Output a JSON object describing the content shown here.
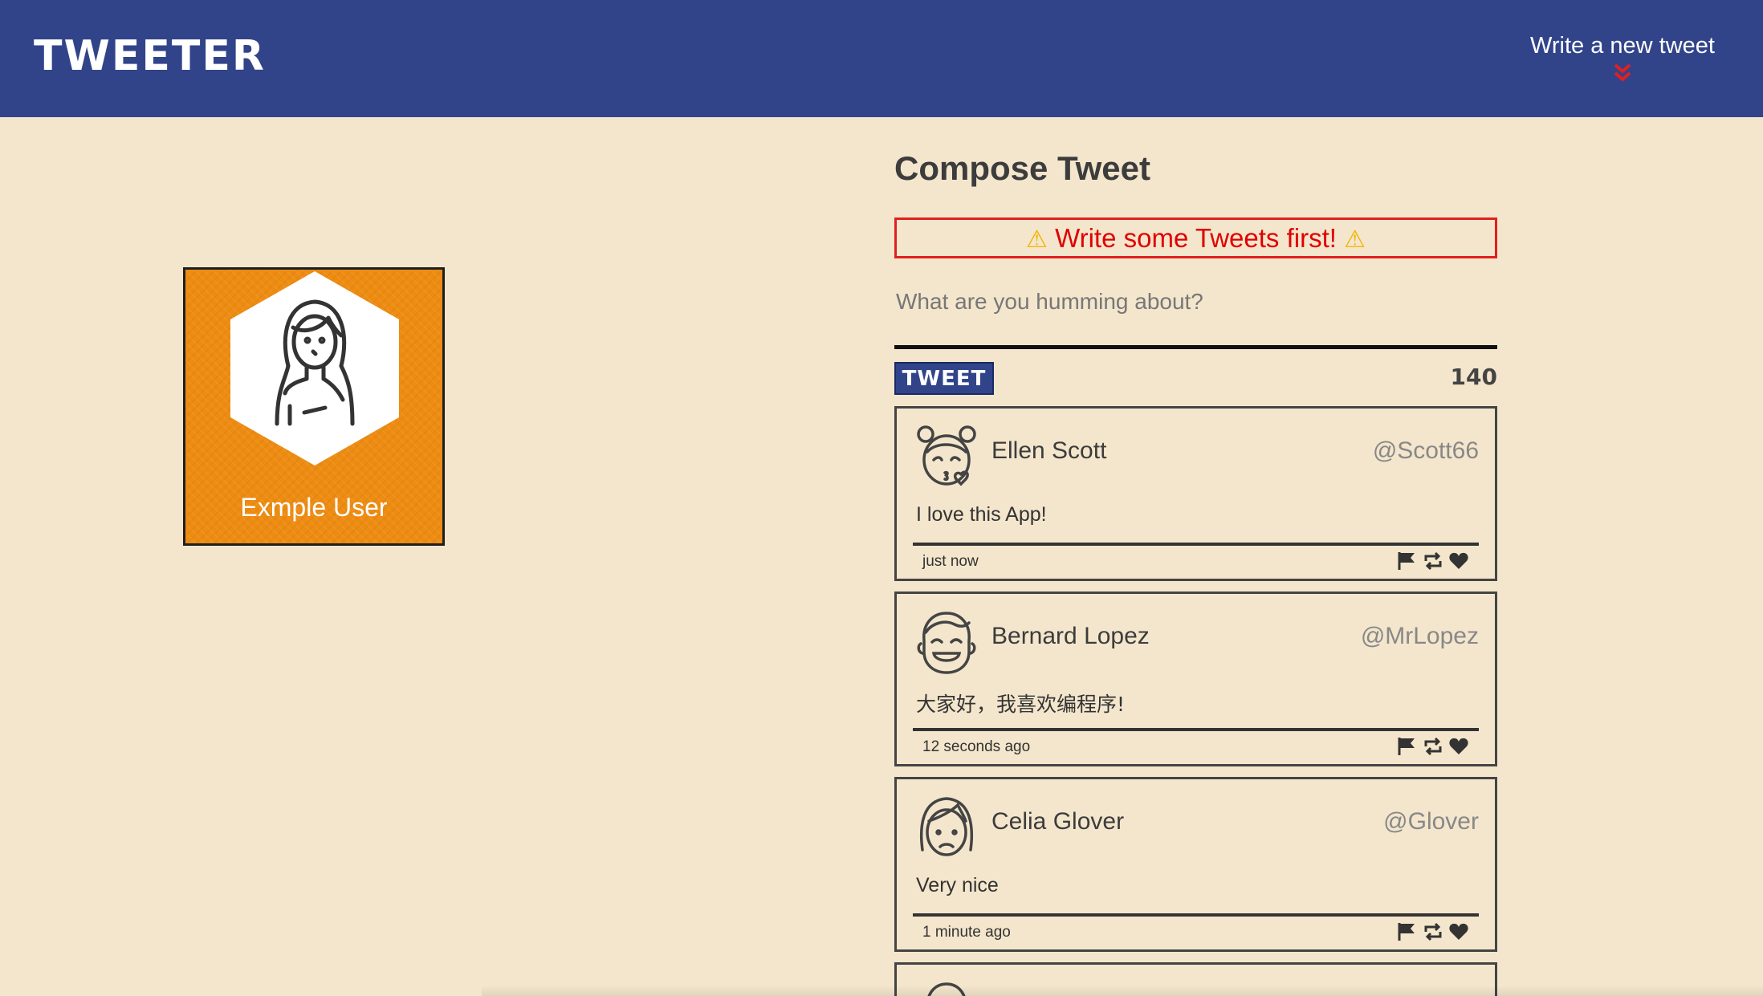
{
  "nav": {
    "brand": "TWEETER",
    "compose_link": "Write a new tweet"
  },
  "profile": {
    "name": "Exmple User"
  },
  "compose": {
    "title": "Compose Tweet",
    "error": "Write some Tweets first!",
    "placeholder": "What are you humming about?",
    "button_label": "TWEET",
    "counter": "140"
  },
  "tweets": [
    {
      "name": "Ellen Scott",
      "handle": "@Scott66",
      "text": "I love this App!",
      "time": "just now",
      "avatar_icon": "kissing-girl-icon"
    },
    {
      "name": "Bernard Lopez",
      "handle": "@MrLopez",
      "text": "大家好，我喜欢编程序!",
      "time": "12 seconds ago",
      "avatar_icon": "laughing-man-icon"
    },
    {
      "name": "Celia Glover",
      "handle": "@Glover",
      "text": "Very nice",
      "time": "1 minute ago",
      "avatar_icon": "sad-woman-icon"
    }
  ],
  "colors": {
    "nav_bg": "#31448a",
    "page_bg": "#f4e6cc",
    "profile_bg": "#ee8c12",
    "error": "#e00000"
  }
}
